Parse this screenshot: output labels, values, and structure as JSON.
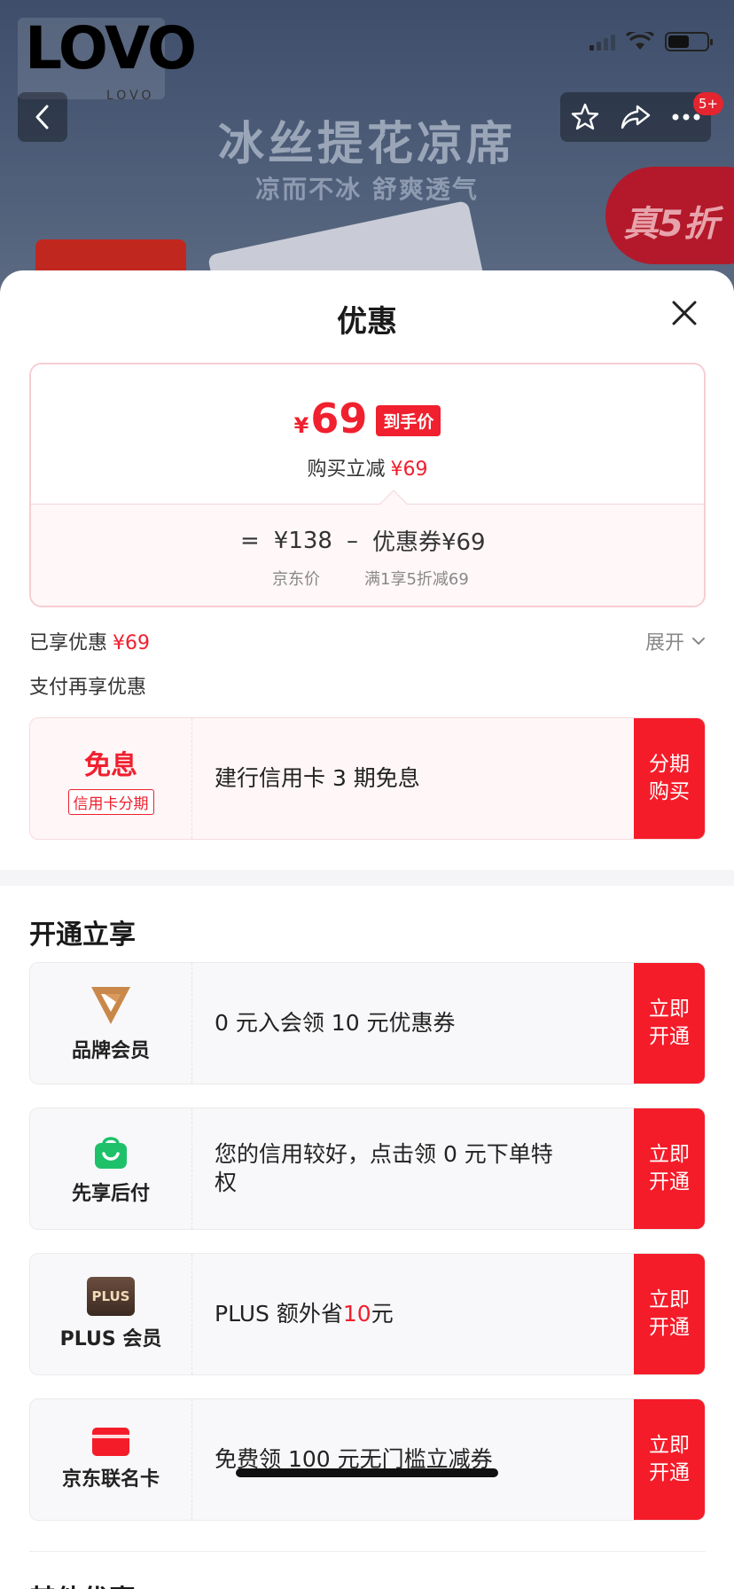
{
  "header": {
    "logo_text": "LOVO",
    "logo_small": "LOVO",
    "badge": "5+"
  },
  "banner": {
    "title": "冰丝提花凉席",
    "subtitle": "凉而不冰 舒爽透气",
    "deal": "真5折"
  },
  "sheet": {
    "title": "优惠",
    "price": {
      "currency": "¥",
      "amount": "69",
      "tag": "到手价",
      "reduce_label": "购买立减",
      "reduce_value": "¥69",
      "formula_eq": "=",
      "jd_price": "¥138",
      "minus": "–",
      "coupon": "优惠券¥69",
      "jd_price_label": "京东价",
      "coupon_desc": "满1享5折减69"
    },
    "enjoyed_label": "已享优惠",
    "enjoyed_value": "¥69",
    "expand_label": "展开",
    "pay_more_label": "支付再享优惠",
    "installment": {
      "title": "免息",
      "tag": "信用卡分期",
      "desc": "建行信用卡 3 期免息",
      "button": "分期购买"
    },
    "open_section_title": "开通立享",
    "offers": [
      {
        "label": "品牌会员",
        "desc": "0 元入会领 10 元优惠券",
        "button": "立即开通"
      },
      {
        "label": "先享后付",
        "desc": "您的信用较好，点击领 0 元下单特权",
        "button": "立即开通"
      },
      {
        "label": "PLUS 会员",
        "icon_text": "PLUS",
        "desc_prefix": "PLUS 额外省 ",
        "desc_highlight": "10",
        "desc_suffix": " 元",
        "button": "立即开通"
      },
      {
        "label": "京东联名卡",
        "desc": "免费领 100 元无门槛立减券",
        "button": "立即开通"
      }
    ],
    "next_section_title": "其他优惠"
  },
  "colors": {
    "accent": "#f51c2a",
    "price_red": "#f0202f"
  }
}
